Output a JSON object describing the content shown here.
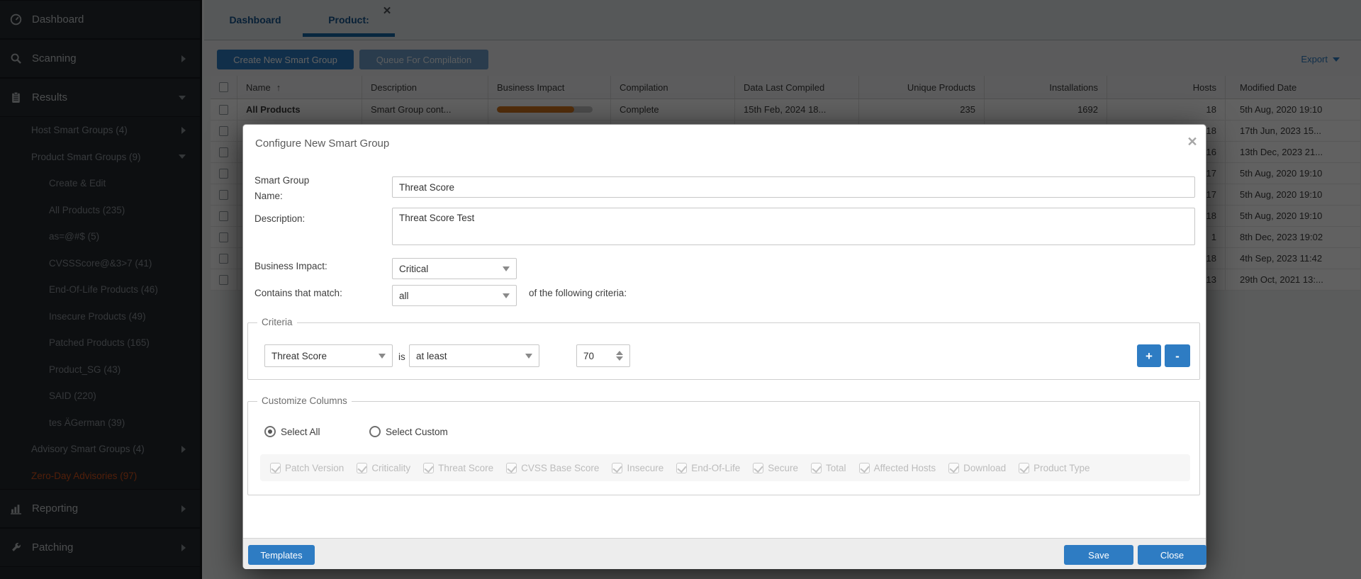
{
  "colors": {
    "accent": "#2e7cc3",
    "bar_orange": "#d97a1f",
    "zero_day_red": "#d4531c",
    "tab_blue": "#15568f"
  },
  "sidebar": {
    "items": [
      {
        "label": "Dashboard",
        "level": 1,
        "header": true,
        "icon": "gauge-icon"
      },
      {
        "label": "Scanning",
        "level": 1,
        "header": true,
        "icon": "search-icon",
        "arrow": "right"
      },
      {
        "label": "Results",
        "level": 1,
        "header": true,
        "icon": "clipboard-icon",
        "arrow": "down"
      },
      {
        "label": "Host Smart Groups (4)",
        "level": 2,
        "arrow": "right"
      },
      {
        "label": "Product Smart Groups (9)",
        "level": 2,
        "arrow": "down"
      },
      {
        "label": "Create & Edit",
        "level": 3
      },
      {
        "label": "All Products (235)",
        "level": 3
      },
      {
        "label": "as=@#$ (5)",
        "level": 3
      },
      {
        "label": "CVSSScore@&3>7 (41)",
        "level": 3
      },
      {
        "label": "End-Of-Life Products (46)",
        "level": 3
      },
      {
        "label": "Insecure Products (49)",
        "level": 3
      },
      {
        "label": "Patched Products (165)",
        "level": 3
      },
      {
        "label": "Product_SG (43)",
        "level": 3
      },
      {
        "label": "SAID (220)",
        "level": 3
      },
      {
        "label": "tes ÄGerman (39)",
        "level": 3
      },
      {
        "label": "Advisory Smart Groups (4)",
        "level": 2,
        "arrow": "right"
      },
      {
        "label": "Zero-Day Advisories (97)",
        "level": 2,
        "color": "#d4531c"
      },
      {
        "label": "Reporting",
        "level": 1,
        "header": true,
        "icon": "chart-icon",
        "arrow": "right"
      },
      {
        "label": "Patching",
        "level": 1,
        "header": true,
        "icon": "wrench-icon",
        "arrow": "right"
      }
    ]
  },
  "tabs": {
    "dashboard": "Dashboard",
    "product": "Product:",
    "close_icon": "✕"
  },
  "toolbar": {
    "create_label": "Create New Smart Group",
    "queue_label": "Queue For Compilation",
    "export_label": "Export"
  },
  "table": {
    "columns": [
      "",
      "Name",
      "Description",
      "Business Impact",
      "Compilation",
      "Data Last Compiled",
      "Unique Products",
      "Installations",
      "Hosts",
      "Modified Date"
    ],
    "sort": {
      "column": "Name",
      "direction": "asc",
      "icon": "↑"
    },
    "rows": [
      {
        "name": "All Products",
        "bold": true,
        "description": "Smart Group cont...",
        "business_impact_pct": 81,
        "compilation": "Complete",
        "data_last_compiled": "15th Feb, 2024 18...",
        "unique_products": "235",
        "installations": "1692",
        "hosts": "18",
        "modified": "5th Aug, 2020 19:10"
      },
      {
        "hosts": "18",
        "modified": "17th Jun, 2023 15..."
      },
      {
        "hosts": "16",
        "modified": "13th Dec, 2023 21..."
      },
      {
        "hosts": "17",
        "modified": "5th Aug, 2020 19:10"
      },
      {
        "hosts": "17",
        "modified": "5th Aug, 2020 19:10"
      },
      {
        "hosts": "18",
        "modified": "5th Aug, 2020 19:10"
      },
      {
        "hosts": "1",
        "modified": "8th Dec, 2023 19:02"
      },
      {
        "hosts": "18",
        "modified": "4th Sep, 2023 11:42"
      },
      {
        "hosts": "13",
        "modified": "29th Oct, 2021 13:..."
      }
    ]
  },
  "modal": {
    "title": "Configure New Smart Group",
    "close_icon": "✕",
    "fields": {
      "name_label": "Smart Group Name:",
      "name_value": "Threat Score",
      "description_label": "Description:",
      "description_value": "Threat Score Test",
      "business_impact_label": "Business Impact:",
      "business_impact_value": "Critical",
      "contains_label": "Contains that match:",
      "contains_value": "all",
      "contains_suffix": "of the following criteria:"
    },
    "criteria": {
      "legend": "Criteria",
      "field_value": "Threat Score",
      "is_label": "is",
      "operator_value": "at least",
      "threshold_value": "70",
      "add_label": "+",
      "remove_label": "-"
    },
    "customize": {
      "legend": "Customize Columns",
      "select_all_label": "Select All",
      "select_custom_label": "Select Custom",
      "selected_mode": "all",
      "columns": [
        "Patch Version",
        "Criticality",
        "Threat Score",
        "CVSS Base Score",
        "Insecure",
        "End-Of-Life",
        "Secure",
        "Total",
        "Affected Hosts",
        "Download",
        "Product Type"
      ]
    },
    "footer": {
      "templates": "Templates",
      "save": "Save",
      "close": "Close"
    }
  }
}
